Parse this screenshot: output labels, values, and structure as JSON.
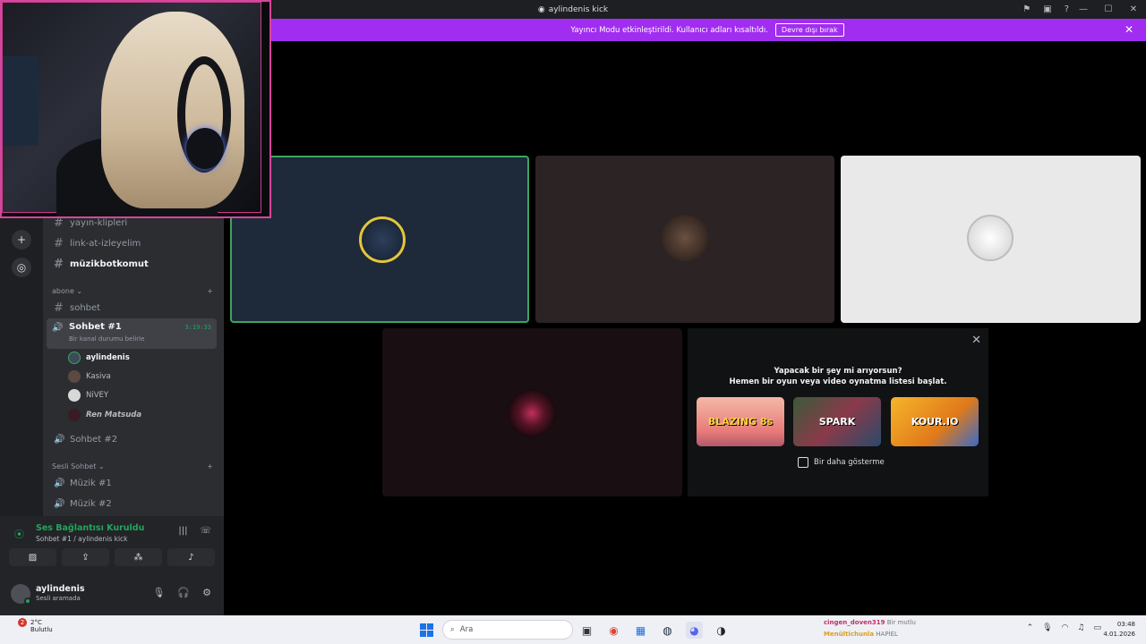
{
  "window": {
    "title": "aylindenis kick"
  },
  "banner": {
    "message": "Yayıncı Modu etkinleştirildi. Kullanıcı adları kısaltıldı.",
    "button": "Devre dışı bırak"
  },
  "channels": {
    "text": [
      {
        "name": "yayın-klipleri"
      },
      {
        "name": "link-at-izleyelim"
      },
      {
        "name": "müzikbotkomut"
      }
    ],
    "category_abone": "abone",
    "sohbet": "sohbet",
    "voice_active": {
      "name": "Sohbet #1",
      "status": "Bir kanal durumu belirle",
      "time": "3:19:33"
    },
    "members": [
      "aylindenis",
      "Kasiva",
      "NiVEY",
      "Ren Matsuda"
    ],
    "voice_2": "Sohbet #2",
    "category_sesli": "Sesli Sohbet",
    "music": [
      "Müzik #1",
      "Müzik #2"
    ]
  },
  "voice_panel": {
    "connected": "Ses Bağlantısı Kuruldu",
    "channel": "Sohbet #1 / aylindenis kick"
  },
  "user": {
    "name": "aylindenis",
    "status": "Sesli aramada"
  },
  "activity": {
    "question1": "Yapacak bir şey mi arıyorsun?",
    "question2": "Hemen bir oyun veya video oynatma listesi başlat.",
    "games": [
      "BLAZING 8s",
      "SPARK",
      "KOUR.IO"
    ],
    "checkbox": "Bir daha gösterme"
  },
  "taskbar": {
    "weather_temp": "2°C",
    "weather_desc": "Bulutlu",
    "badge": "2",
    "search_placeholder": "Ara",
    "chat_line1_user": "cingen_doven319",
    "chat_line1_text": "Bir mutlu",
    "chat_line2_user": "Menültichunla",
    "chat_line2_text": "HAPİEL",
    "time": "03:48",
    "date": "4.01.2026"
  },
  "colors": {
    "accent": "#a12df0",
    "online": "#23a55a",
    "speaking": "#3ba55c"
  }
}
